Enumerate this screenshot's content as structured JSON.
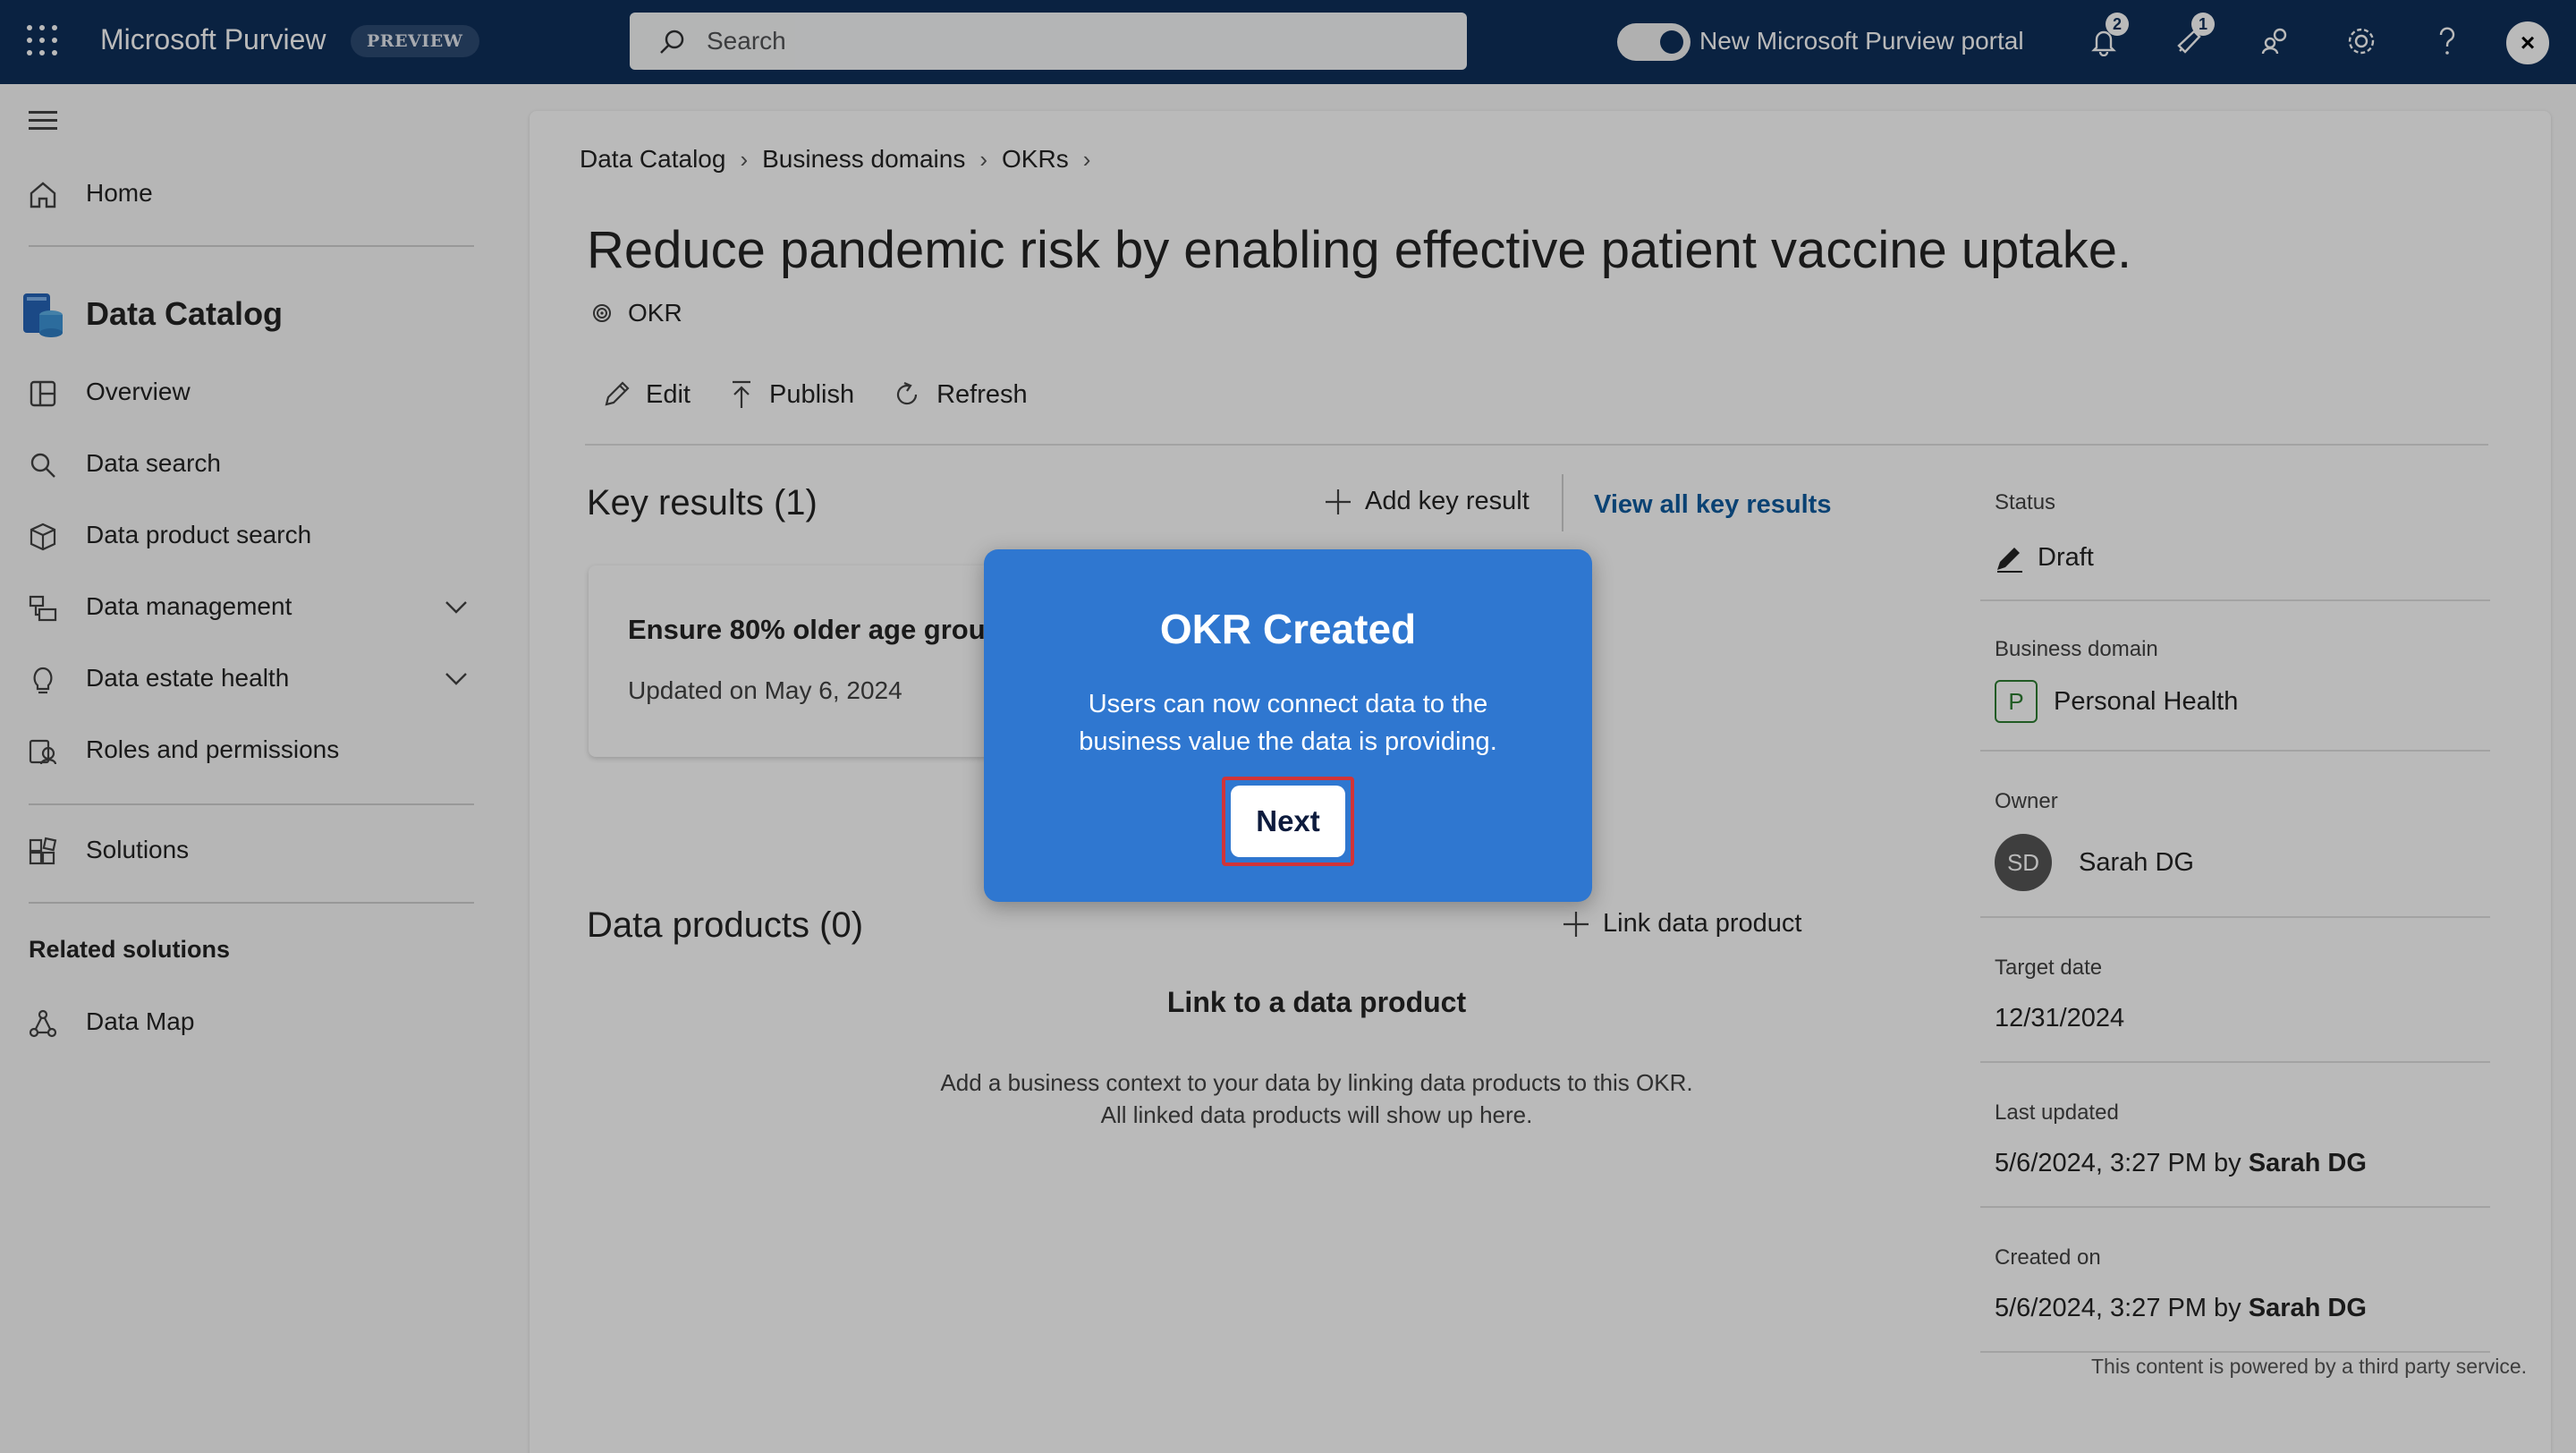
{
  "topbar": {
    "app_title": "Microsoft Purview",
    "preview_badge": "PREVIEW",
    "search_placeholder": "Search",
    "toggle_label": "New Microsoft Purview portal",
    "notification_count": "2",
    "feedback_count": "1",
    "avatar_glyph": "×",
    "icons": [
      "waffle-icon",
      "search-icon",
      "bell-icon",
      "megaphone-icon",
      "people-icon",
      "gear-icon",
      "help-icon"
    ]
  },
  "sidebar": {
    "home": "Home",
    "section_title": "Data Catalog",
    "items": [
      {
        "label": "Overview",
        "icon": "overview-icon"
      },
      {
        "label": "Data search",
        "icon": "search-icon"
      },
      {
        "label": "Data product search",
        "icon": "cube-icon"
      },
      {
        "label": "Data management",
        "icon": "data-management-icon"
      },
      {
        "label": "Data estate health",
        "icon": "lightbulb-icon"
      },
      {
        "label": "Roles and permissions",
        "icon": "roles-icon"
      }
    ],
    "solutions": "Solutions",
    "related_heading": "Related solutions",
    "data_map": "Data Map"
  },
  "breadcrumb": [
    "Data Catalog",
    "Business domains",
    "OKRs"
  ],
  "page": {
    "title": "Reduce pandemic risk by enabling effective patient vaccine uptake.",
    "type_label": "OKR"
  },
  "toolbar": {
    "edit": "Edit",
    "publish": "Publish",
    "refresh": "Refresh"
  },
  "key_results": {
    "heading": "Key results (1)",
    "add_label": "Add key result",
    "view_all": "View all key results",
    "card_title": "Ensure 80% older age grou",
    "card_updated": "Updated on May 6, 2024"
  },
  "data_products": {
    "heading": "Data products (0)",
    "link_label": "Link data product",
    "empty_title": "Link to a data product",
    "empty_line1": "Add a business context to your data by linking data products to this OKR.",
    "empty_line2": "All linked data products will show up here."
  },
  "properties": {
    "status_label": "Status",
    "status_value": "Draft",
    "domain_label": "Business domain",
    "domain_initial": "P",
    "domain_value": "Personal Health",
    "owner_label": "Owner",
    "owner_initials": "SD",
    "owner_value": "Sarah DG",
    "target_label": "Target date",
    "target_value": "12/31/2024",
    "updated_label": "Last updated",
    "updated_value": "5/6/2024, 3:27 PM by",
    "updated_by": "Sarah DG",
    "created_label": "Created on",
    "created_value": "5/6/2024, 3:27 PM by",
    "created_by": "Sarah DG"
  },
  "footer_note": "This content is powered by a third party service.",
  "modal": {
    "title": "OKR Created",
    "body": "Users can now connect data to the business value the data is providing.",
    "next": "Next"
  },
  "colors": {
    "topbar": "#0f2f5a",
    "modal": "#2f77d0",
    "highlight": "#d13438",
    "link": "#0f5b9e"
  }
}
